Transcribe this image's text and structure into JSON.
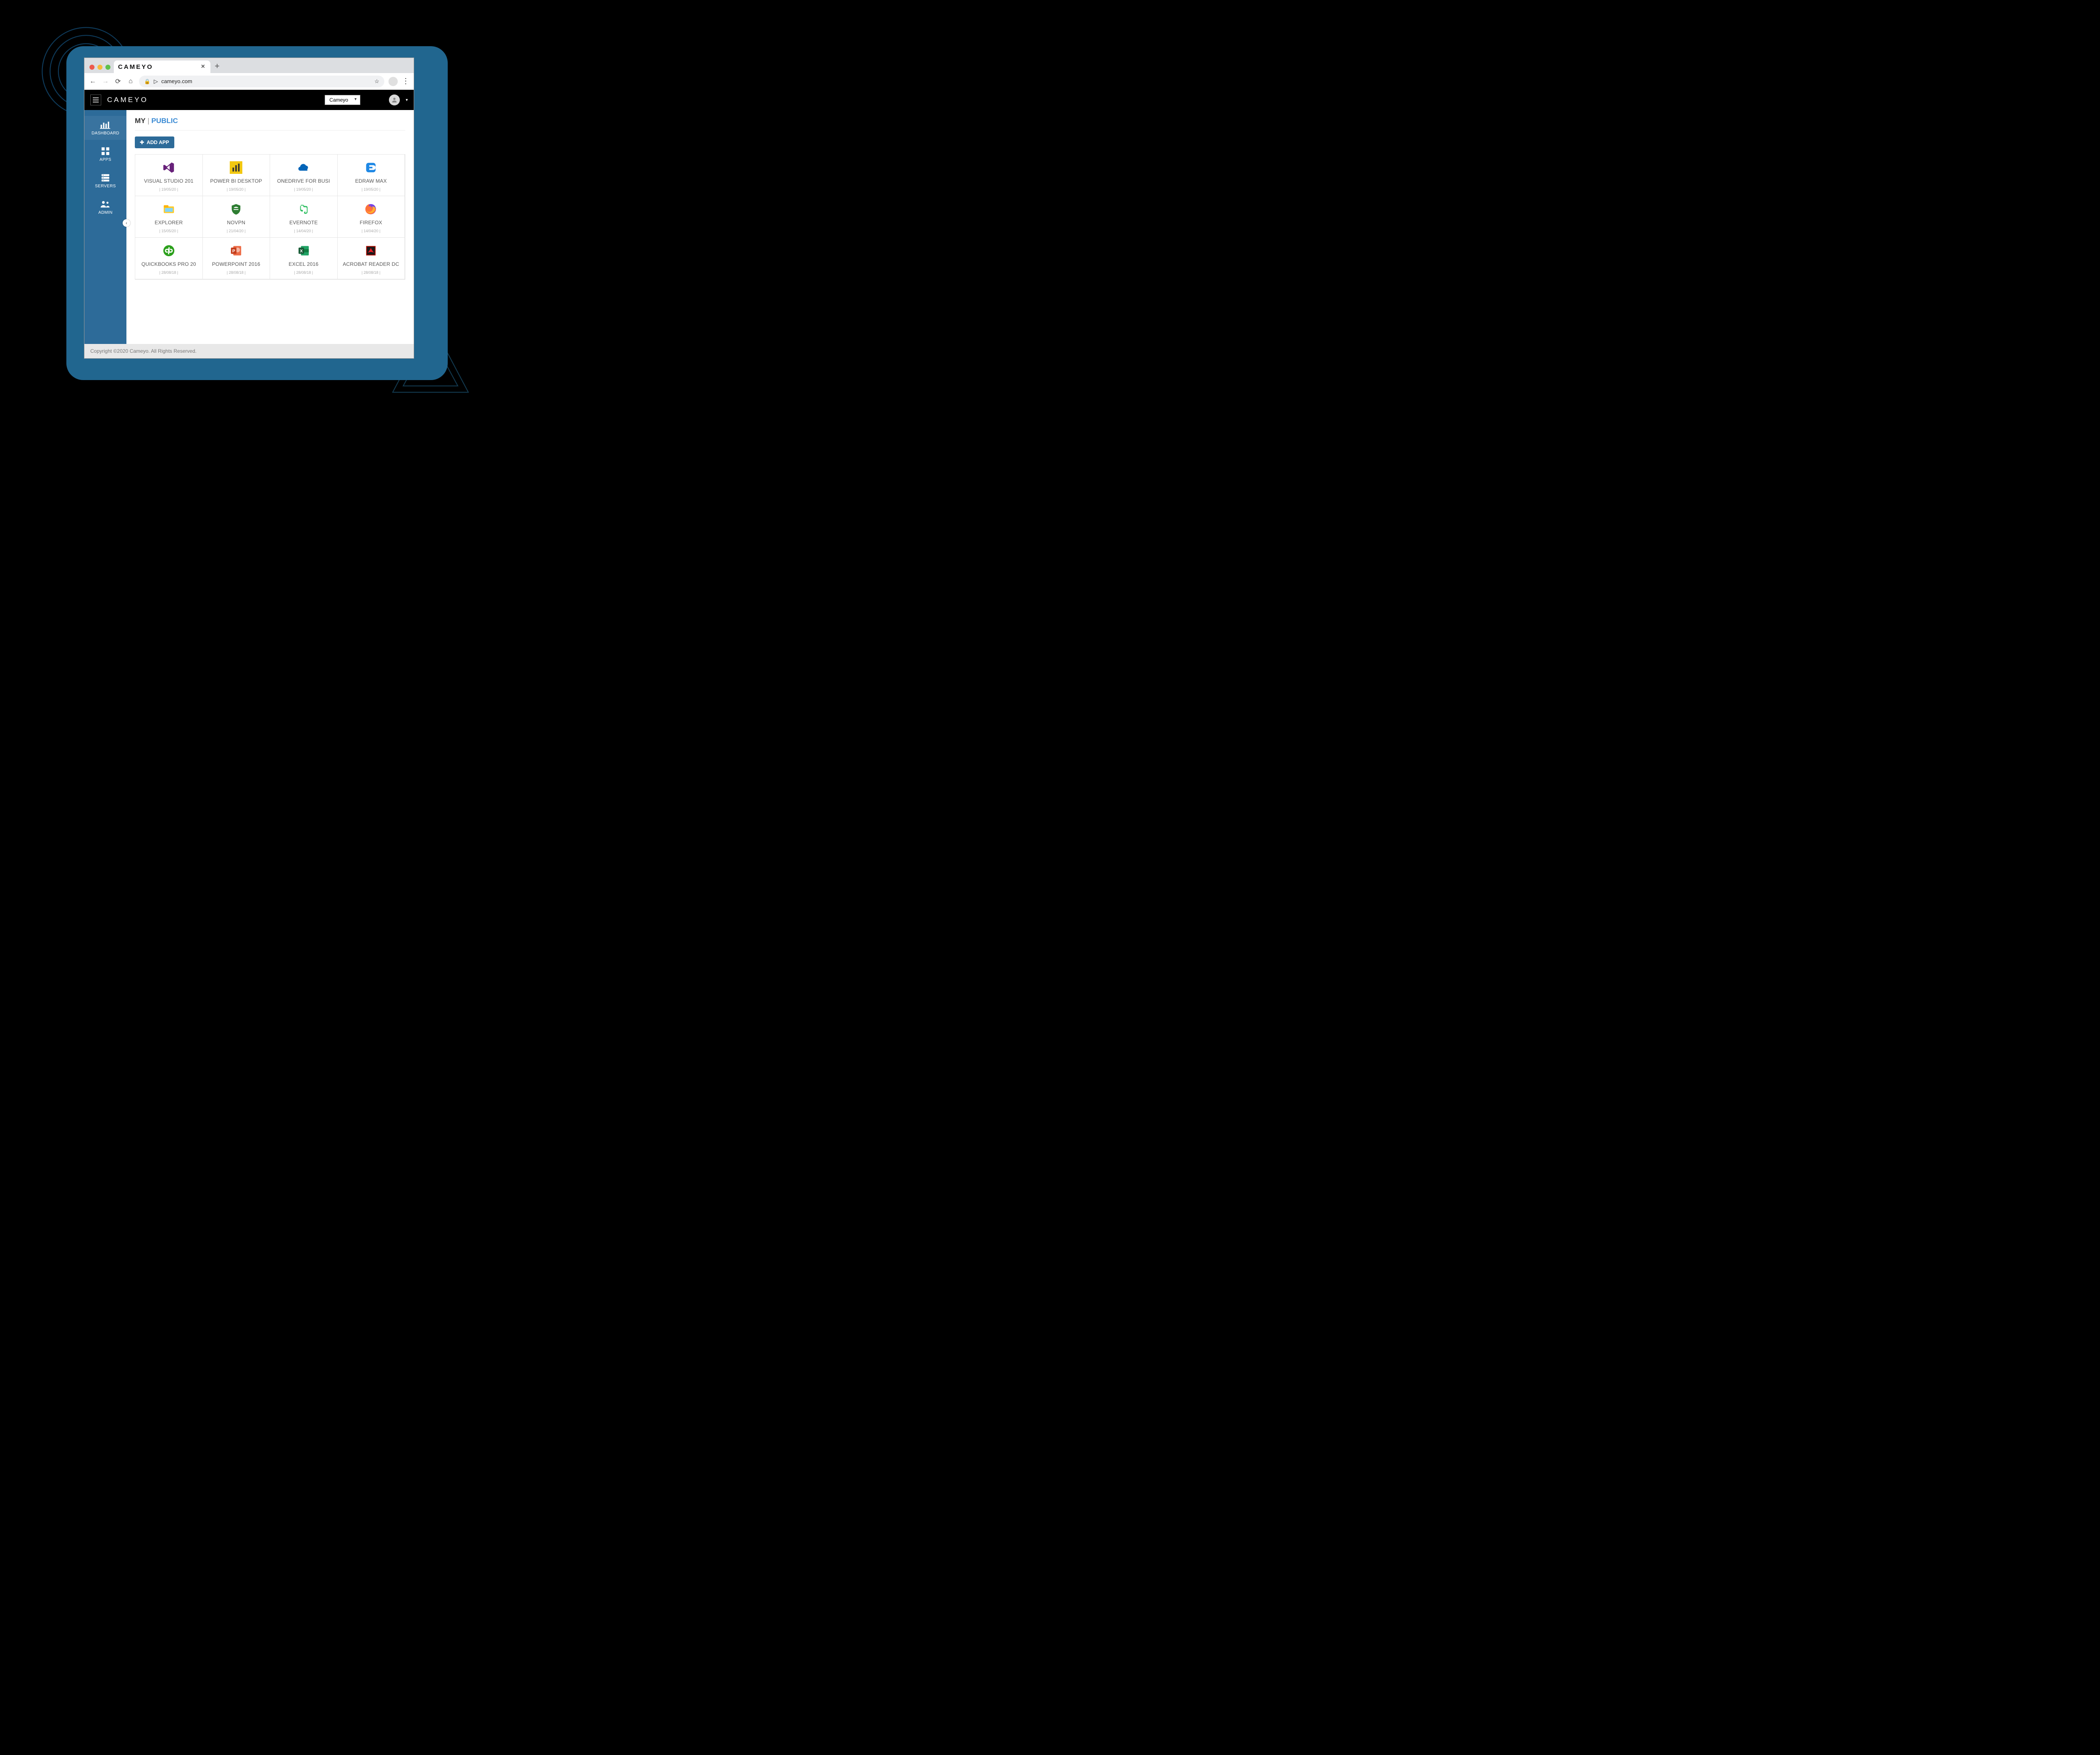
{
  "browser": {
    "tab_title": "CAMEYO",
    "url_display": "cameyo.com"
  },
  "app": {
    "brand": "CAMEYO",
    "tenant": "Cameyo"
  },
  "sidebar": {
    "items": [
      {
        "label": "DASHBOARD"
      },
      {
        "label": "APPS"
      },
      {
        "label": "SERVERS"
      },
      {
        "label": "ADMIN"
      }
    ]
  },
  "crumb": {
    "my": "MY",
    "sep": " | ",
    "public": "PUBLIC"
  },
  "buttons": {
    "add_app": "ADD APP"
  },
  "apps": [
    {
      "name": "VISUAL STUDIO 201",
      "date": "| 19/05/20 |",
      "icon": "visualstudio"
    },
    {
      "name": "POWER BI DESKTOP",
      "date": "| 19/05/20 |",
      "icon": "powerbi"
    },
    {
      "name": "ONEDRIVE FOR BUSI",
      "date": "| 19/05/20 |",
      "icon": "onedrive"
    },
    {
      "name": "EDRAW MAX",
      "date": "| 19/05/20 |",
      "icon": "edraw"
    },
    {
      "name": "EXPLORER",
      "date": "| 15/05/20 |",
      "icon": "explorer"
    },
    {
      "name": "NOVPN",
      "date": "| 21/04/20 |",
      "icon": "novpn"
    },
    {
      "name": "EVERNOTE",
      "date": "| 14/04/20 |",
      "icon": "evernote"
    },
    {
      "name": "FIREFOX",
      "date": "| 14/04/20 |",
      "icon": "firefox"
    },
    {
      "name": "QUICKBOOKS PRO 20",
      "date": "| 28/08/18 |",
      "icon": "quickbooks"
    },
    {
      "name": "POWERPOINT 2016",
      "date": "| 28/08/18 |",
      "icon": "powerpoint"
    },
    {
      "name": "EXCEL 2016",
      "date": "| 28/08/18 |",
      "icon": "excel"
    },
    {
      "name": "ACROBAT READER DC",
      "date": "| 28/08/18 |",
      "icon": "acrobat"
    }
  ],
  "footer": "Copyright ©2020 Cameyo. All Rights Reserved."
}
